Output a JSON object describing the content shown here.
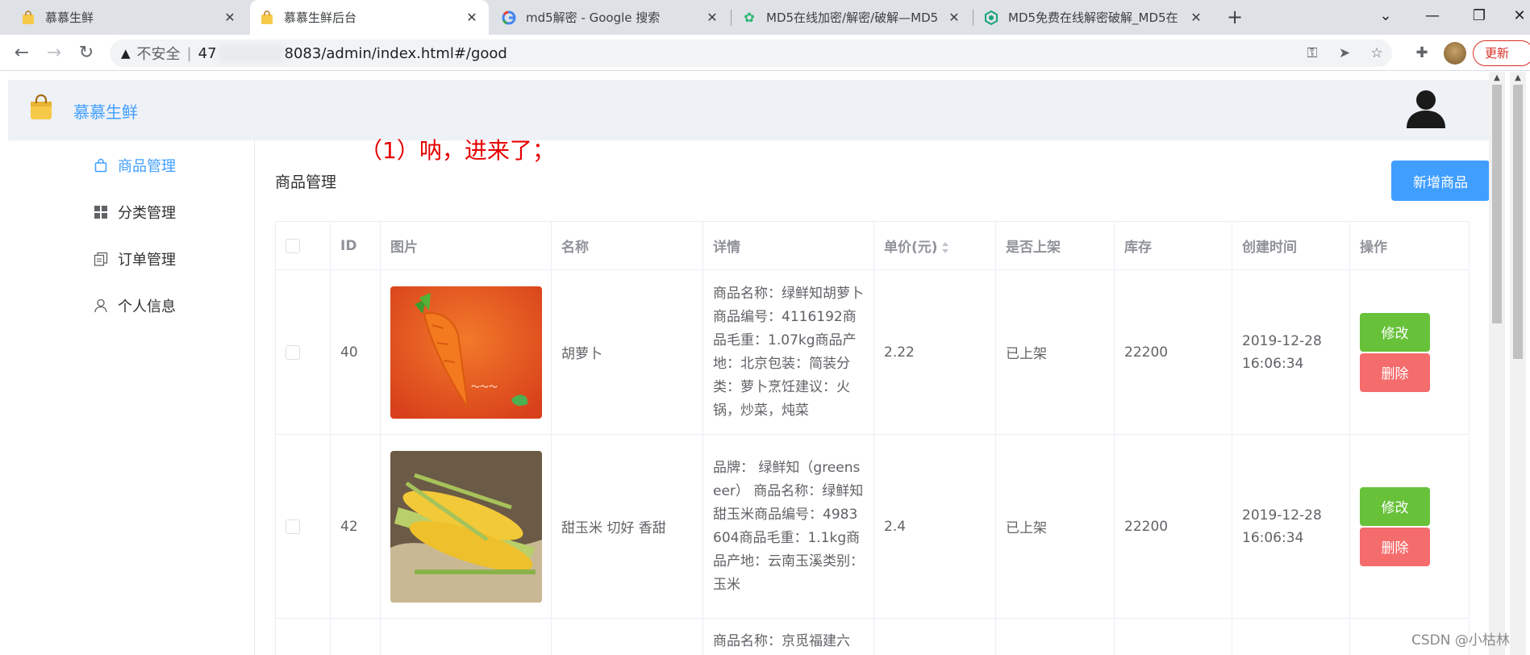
{
  "browser": {
    "tabs": [
      {
        "title": "慕慕生鲜",
        "icon": "shopping-bag-icon",
        "active": false
      },
      {
        "title": "慕慕生鲜后台",
        "icon": "shopping-bag-icon",
        "active": true
      },
      {
        "title": "md5解密 - Google 搜索",
        "icon": "google-g-icon",
        "active": false
      },
      {
        "title": "MD5在线加密/解密/破解—MD5",
        "icon": "gear-icon",
        "active": false
      },
      {
        "title": "MD5免费在线解密破解_MD5在",
        "icon": "cmd5-icon",
        "active": false
      }
    ],
    "address": {
      "security_label": "不安全",
      "host_prefix": "47",
      "host_suffix": "8083/admin/index.html#/good"
    },
    "update_label": "更新"
  },
  "app": {
    "brand": "慕慕生鲜",
    "sidebar": [
      {
        "label": "商品管理",
        "icon": "bag-icon",
        "active": true
      },
      {
        "label": "分类管理",
        "icon": "grid-icon",
        "active": false
      },
      {
        "label": "订单管理",
        "icon": "document-icon",
        "active": false
      },
      {
        "label": "个人信息",
        "icon": "person-icon",
        "active": false
      }
    ],
    "annotation": "（1）呐，进来了；",
    "page_title": "商品管理",
    "add_button": "新增商品",
    "table": {
      "headers": [
        "ID",
        "图片",
        "名称",
        "详情",
        "单价(元)",
        "是否上架",
        "库存",
        "创建时间",
        "操作"
      ],
      "rows": [
        {
          "id": "40",
          "image": "carrot",
          "name": "胡萝卜",
          "detail": "商品名称：绿鲜知胡萝卜商品编号：4116192商品毛重：1.07kg商品产地：北京包装：简装分类：萝卜烹饪建议：火锅，炒菜，炖菜",
          "price": "2.22",
          "status": "已上架",
          "stock": "22200",
          "created": "2019-12-28 16:06:34",
          "edit": "修改",
          "delete": "删除"
        },
        {
          "id": "42",
          "image": "corn",
          "name": "甜玉米 切好 香甜",
          "detail": "品牌： 绿鲜知（greenseer） 商品名称：绿鲜知甜玉米商品编号：4983604商品毛重：1.1kg商品产地：云南玉溪类别：玉米",
          "price": "2.4",
          "status": "已上架",
          "stock": "22200",
          "created": "2019-12-28 16:06:34",
          "edit": "修改",
          "delete": "删除"
        },
        {
          "id": "",
          "image": "",
          "name": "",
          "detail": "商品名称：京觅福建六",
          "price": "",
          "status": "",
          "stock": "",
          "created": "",
          "edit": "",
          "delete": ""
        }
      ]
    }
  },
  "watermark": "CSDN @小枯林",
  "colors": {
    "primary": "#409eff",
    "success": "#67c23a",
    "danger": "#f56c6c",
    "annotation": "#e60000"
  }
}
